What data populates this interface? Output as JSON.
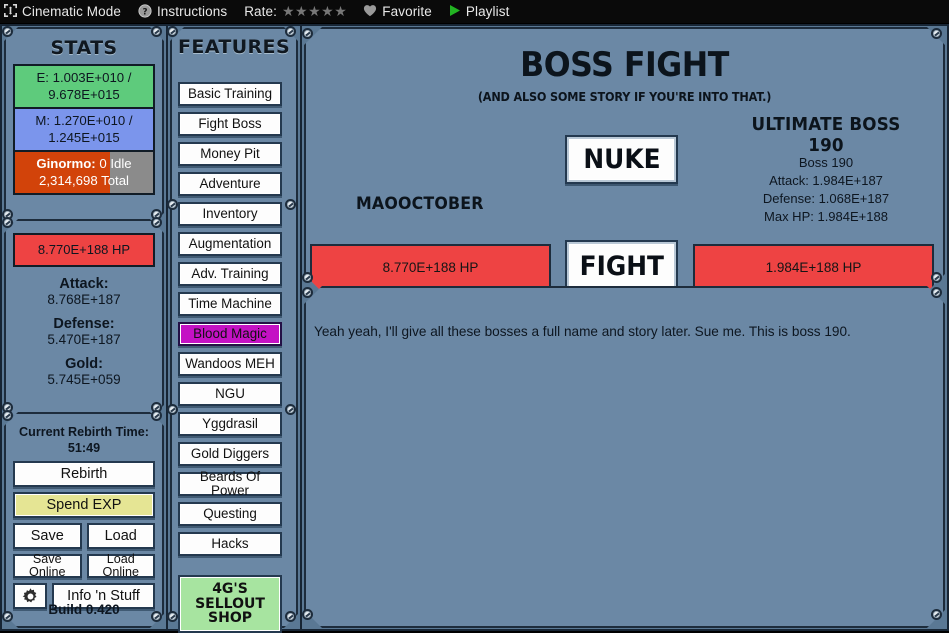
{
  "topbar": {
    "cinematic": {
      "label": "Cinematic Mode",
      "icon": "expand-arrows-icon"
    },
    "instructions": {
      "label": "Instructions",
      "icon": "question-circle-icon"
    },
    "rate": {
      "label": "Rate:",
      "stars": 5,
      "star_glyph": "★",
      "star_color": "#777777"
    },
    "favorite": {
      "label": "Favorite",
      "icon": "heart-icon"
    },
    "playlist": {
      "label": "Playlist",
      "icon": "play-triangle-icon",
      "icon_color": "#22b422"
    }
  },
  "stats": {
    "title": "STATS",
    "energy": {
      "text": "E: 1.003E+010 /",
      "text2": "9.678E+015",
      "color": "#5ecb7c"
    },
    "magic": {
      "text": "M: 1.270E+010 /",
      "text2": "1.245E+015",
      "color": "#7b95ec"
    },
    "ginormo": {
      "label": "Ginormo:",
      "value": "0",
      "state": "Idle",
      "total": "2,314,698 Total",
      "fill_color": "#d2430a",
      "track_color": "#8b8b8b",
      "fill_percent": 69
    },
    "hp": {
      "text": "8.770E+188 HP",
      "color": "#ee4343"
    },
    "attack": {
      "key": "Attack:",
      "value": "8.768E+187"
    },
    "defense": {
      "key": "Defense:",
      "value": "5.470E+187"
    },
    "gold": {
      "key": "Gold:",
      "value": "5.745E+059"
    }
  },
  "rebirth": {
    "time_label": "Current Rebirth Time:",
    "time_value": "51:49",
    "rebirth_button": "Rebirth",
    "spend_exp_button": "Spend EXP",
    "save_button": "Save",
    "load_button": "Load",
    "save_online_button": "Save Online",
    "load_online_button": "Load Online",
    "settings_icon": "gear-icon",
    "info_button": "Info 'n Stuff",
    "build": "Build 0.420"
  },
  "features": {
    "title": "FEATURES",
    "items": [
      {
        "label": "Basic Training",
        "style": "default"
      },
      {
        "label": "Fight Boss",
        "style": "default"
      },
      {
        "label": "Money Pit",
        "style": "default"
      },
      {
        "label": "Adventure",
        "style": "default"
      },
      {
        "label": "Inventory",
        "style": "default"
      },
      {
        "label": "Augmentation",
        "style": "default"
      },
      {
        "label": "Adv. Training",
        "style": "default"
      },
      {
        "label": "Time Machine",
        "style": "default"
      },
      {
        "label": "Blood Magic",
        "style": "magenta"
      },
      {
        "label": "Wandoos MEH",
        "style": "default"
      },
      {
        "label": "NGU",
        "style": "default"
      },
      {
        "label": "Yggdrasil",
        "style": "default"
      },
      {
        "label": "Gold Diggers",
        "style": "default"
      },
      {
        "label": "Beards Of Power",
        "style": "default"
      },
      {
        "label": "Questing",
        "style": "default"
      },
      {
        "label": "Hacks",
        "style": "default"
      }
    ],
    "shop": {
      "line1": "4G'S",
      "line2": "SELLOUT",
      "line3": "SHOP",
      "color": "#a7e4a0"
    }
  },
  "boss": {
    "title": "BOSS FIGHT",
    "subtitle": "(AND ALSO SOME STORY IF YOU'RE INTO THAT.)",
    "nuke_button": "NUKE",
    "player_name": "MAOOCTOBER",
    "ultimate_label": "ULTIMATE BOSS 190",
    "info_name": "Boss 190",
    "info_attack": "Attack: 1.984E+187",
    "info_defense": "Defense: 1.068E+187",
    "info_maxhp": "Max HP: 1.984E+188",
    "player_hp": "8.770E+188 HP",
    "fight_button": "FIGHT",
    "boss_hp": "1.984E+188 HP",
    "story": "Yeah yeah, I'll give all these bosses a full name and story later. Sue me. This is boss 190."
  }
}
